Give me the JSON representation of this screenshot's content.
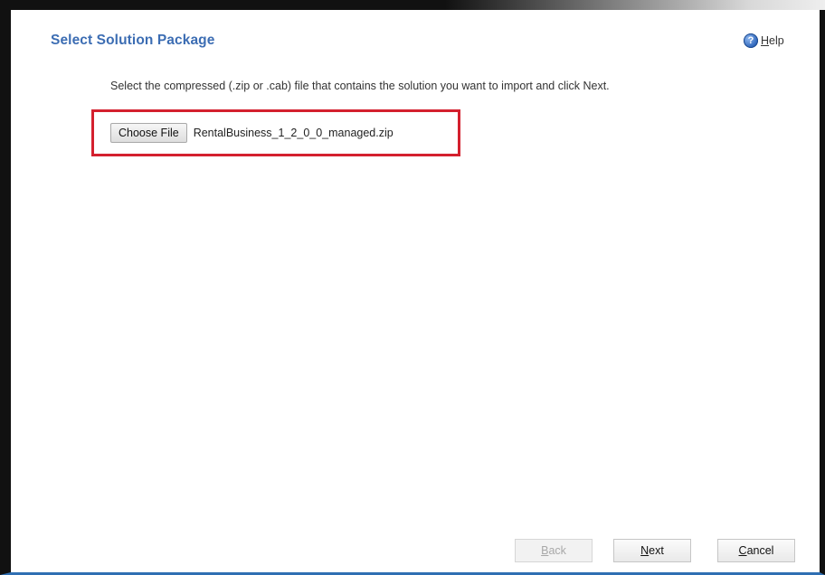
{
  "header": {
    "title": "Select Solution Package",
    "help": {
      "icon": "help-icon",
      "icon_glyph": "?",
      "label_first": "H",
      "label_rest": "elp"
    }
  },
  "main": {
    "instruction": "Select the compressed (.zip or .cab) file that contains the solution you want to import and click Next.",
    "file_input": {
      "button_label": "Choose File",
      "selected_file": "RentalBusiness_1_2_0_0_managed.zip"
    },
    "highlight_color": "#d4202e"
  },
  "footer": {
    "back": {
      "first": "B",
      "rest": "ack",
      "enabled": false
    },
    "next": {
      "first": "N",
      "rest": "ext",
      "enabled": true
    },
    "cancel": {
      "first": "C",
      "rest": "ancel",
      "enabled": true
    }
  },
  "colors": {
    "title": "#3c6db3",
    "frame": "#111111",
    "bottom_border": "#2f6fb3"
  }
}
